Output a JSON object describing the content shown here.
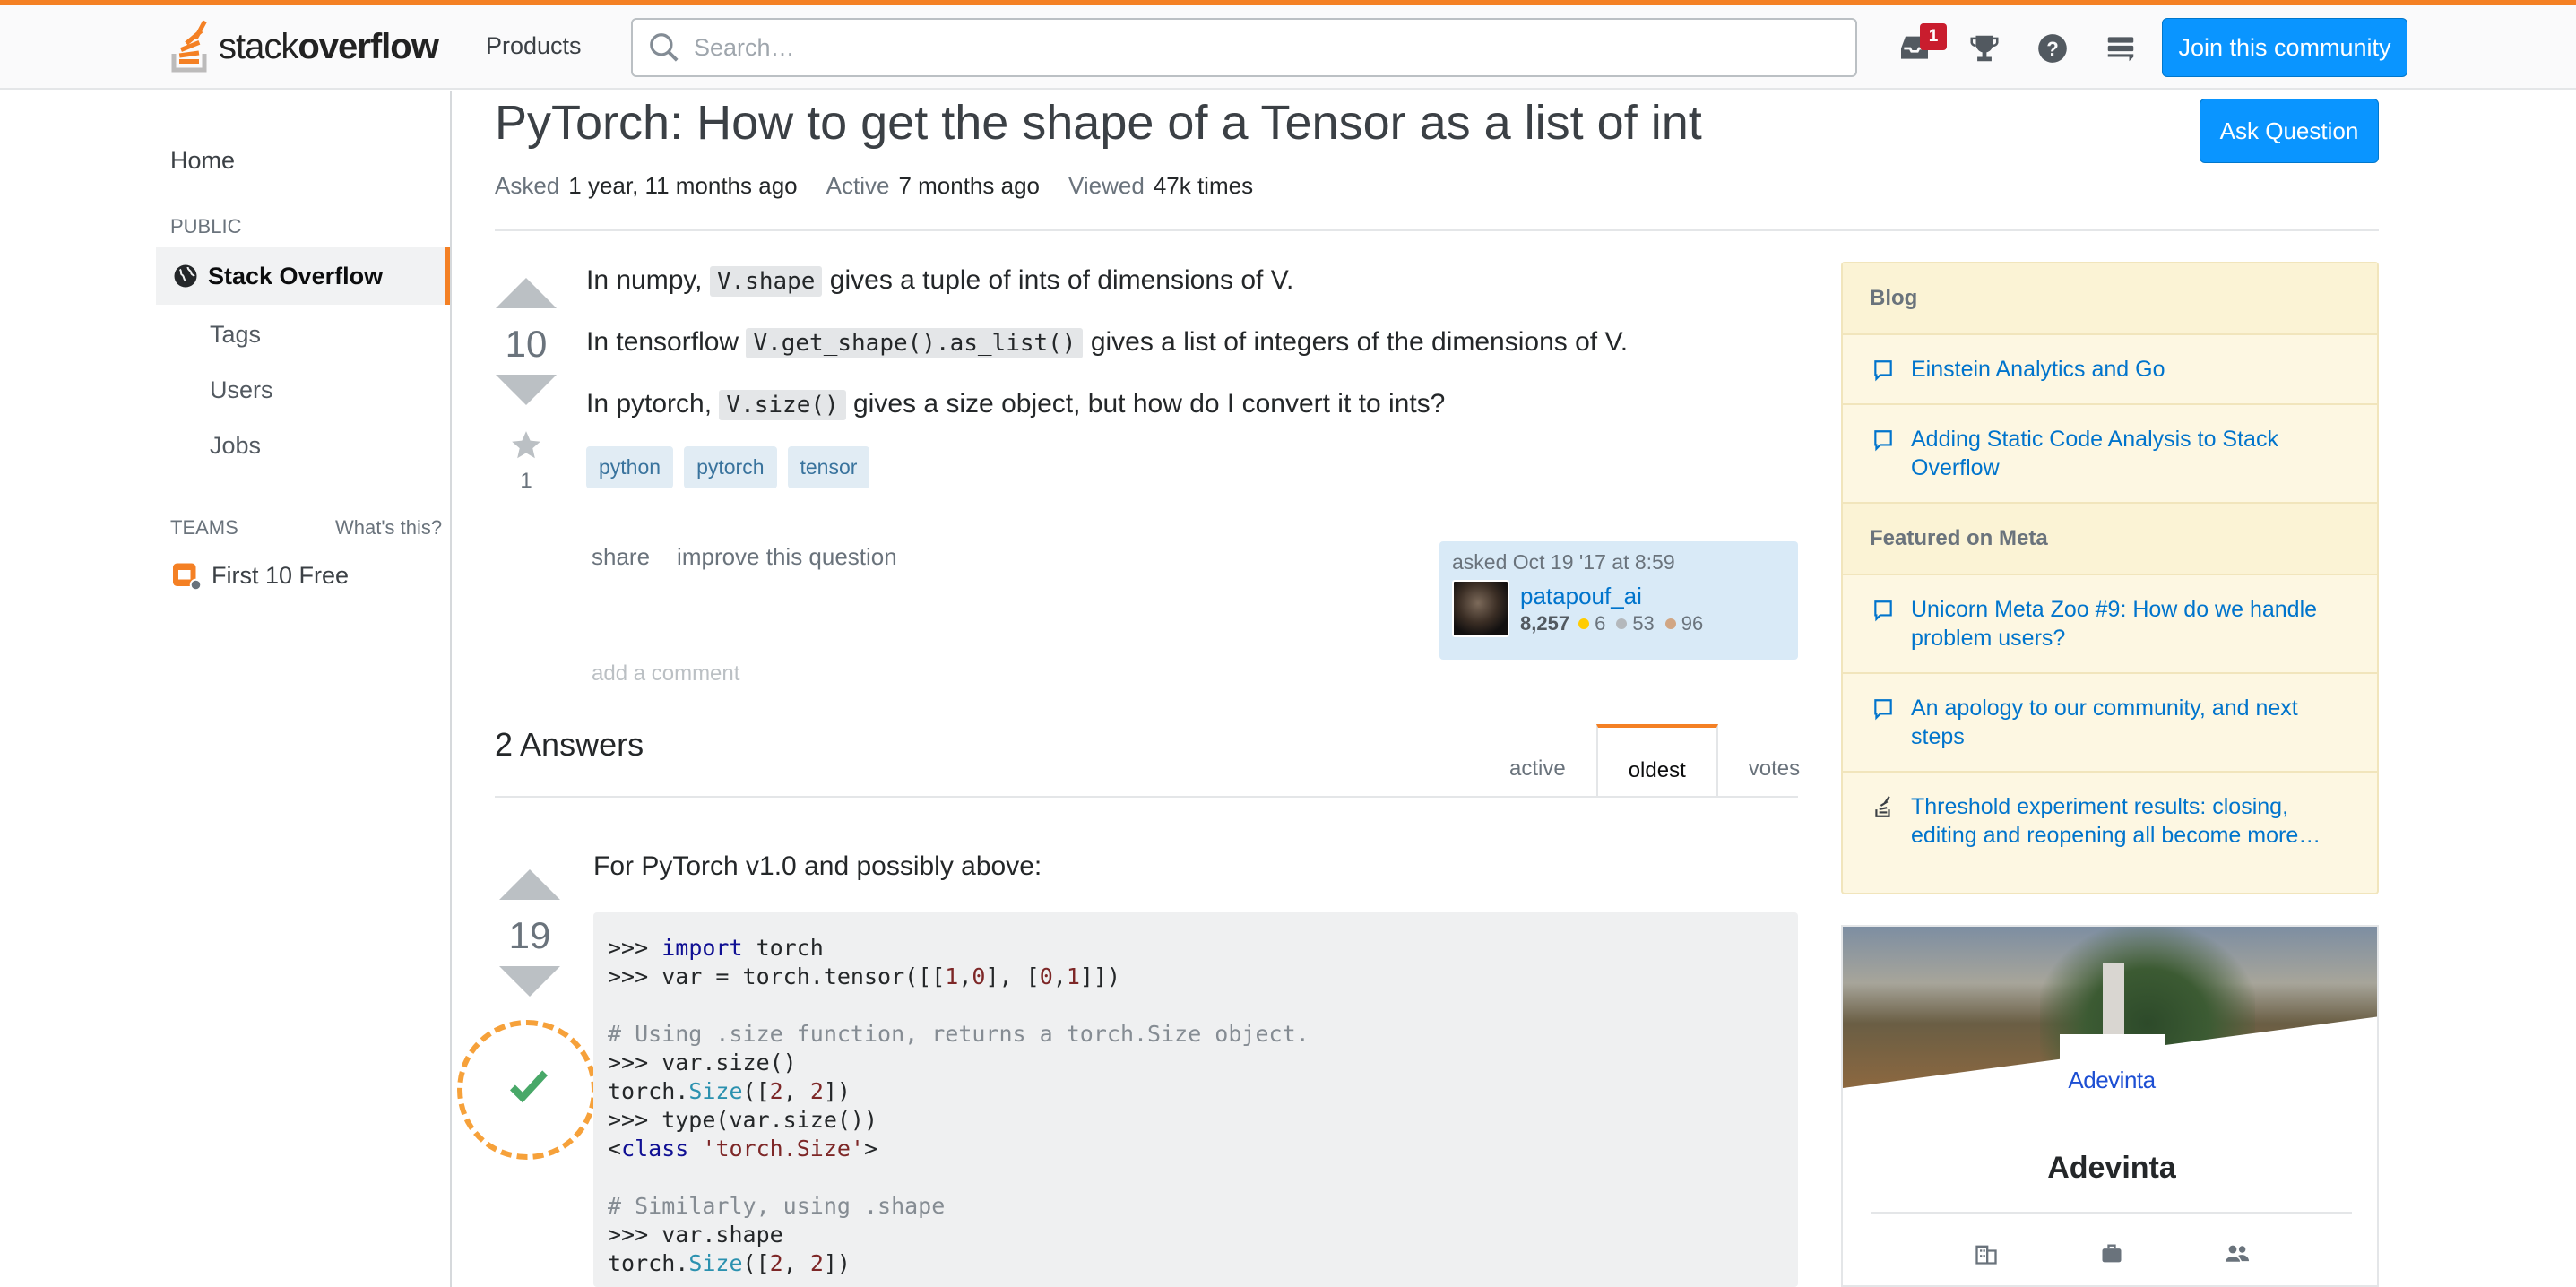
{
  "header": {
    "logo_text_light": "stack",
    "logo_text_bold": "overflow",
    "products_label": "Products",
    "search_placeholder": "Search…",
    "inbox_badge": "1",
    "join_label": "Join this community"
  },
  "sidebar": {
    "home": "Home",
    "public_label": "PUBLIC",
    "stack_overflow": "Stack Overflow",
    "tags": "Tags",
    "users": "Users",
    "jobs": "Jobs",
    "teams_label": "TEAMS",
    "whats_this": "What's this?",
    "first_free": "First 10 Free"
  },
  "question": {
    "title": "PyTorch: How to get the shape of a Tensor as a list of int",
    "ask_button": "Ask Question",
    "asked_label": "Asked",
    "asked_value": "1 year, 11 months ago",
    "active_label": "Active",
    "active_value": "7 months ago",
    "viewed_label": "Viewed",
    "viewed_value": "47k times",
    "votes": "10",
    "favorites": "1",
    "p1_pre": "In numpy,",
    "p1_code": "V.shape",
    "p1_post": "gives a tuple of ints of dimensions of V.",
    "p2_pre": "In tensorflow",
    "p2_code": "V.get_shape().as_list()",
    "p2_post": "gives a list of integers of the dimensions of V.",
    "p3_pre": "In pytorch,",
    "p3_code": "V.size()",
    "p3_post": "gives a size object, but how do I convert it to ints?",
    "tags": [
      "python",
      "pytorch",
      "tensor"
    ],
    "share": "share",
    "improve": "improve this question",
    "asked_on": "asked Oct 19 '17 at 8:59",
    "user": "patapouf_ai",
    "reputation": "8,257",
    "gold": "6",
    "silver": "53",
    "bronze": "96",
    "add_comment": "add a comment"
  },
  "answers": {
    "count_label": "2 Answers",
    "tabs": [
      "active",
      "oldest",
      "votes"
    ],
    "active_tab": "oldest",
    "first_votes": "19",
    "first_text": "For PyTorch v1.0 and possibly above:"
  },
  "code": {
    "l1_prompt": ">>> ",
    "l1_kw": "import",
    "l1_rest": " torch",
    "l2_a": ">>> var = torch.tensor([[",
    "l2_n1": "1",
    "l2_c1": ",",
    "l2_n2": "0",
    "l2_b": "], [",
    "l2_n3": "0",
    "l2_c2": ",",
    "l2_n4": "1",
    "l2_e": "]])",
    "l4_comment": "# Using .size function, returns a torch.Size object.",
    "l5": ">>> var.size()",
    "l6_a": "torch.",
    "l6_ty": "Size",
    "l6_b": "([",
    "l6_n1": "2",
    "l6_c": ", ",
    "l6_n2": "2",
    "l6_e": "])",
    "l7": ">>> type(var.size())",
    "l8_a": "<",
    "l8_kw": "class",
    "l8_sp": " ",
    "l8_st": "'torch.Size'",
    "l8_e": ">",
    "l10_comment": "# Similarly, using .shape",
    "l11": ">>> var.shape",
    "l12_a": "torch.",
    "l12_ty": "Size",
    "l12_b": "([",
    "l12_n1": "2",
    "l12_c": ", ",
    "l12_n2": "2",
    "l12_e": "])"
  },
  "blog": {
    "heading": "Blog",
    "items": [
      "Einstein Analytics and Go",
      "Adding Static Code Analysis to Stack Overflow"
    ],
    "meta_heading": "Featured on Meta",
    "meta_items": [
      "Unicorn Meta Zoo #9: How do we handle problem users?",
      "An apology to our community, and next steps",
      "Threshold experiment results: closing, editing and reopening all become more…"
    ]
  },
  "ad": {
    "logo_text": "Adevinta",
    "company": "Adevinta"
  },
  "colors": {
    "brand_orange": "#f48024",
    "primary_blue": "#0a95ff",
    "link_blue": "#0074cc",
    "accept_green": "#48a868"
  }
}
